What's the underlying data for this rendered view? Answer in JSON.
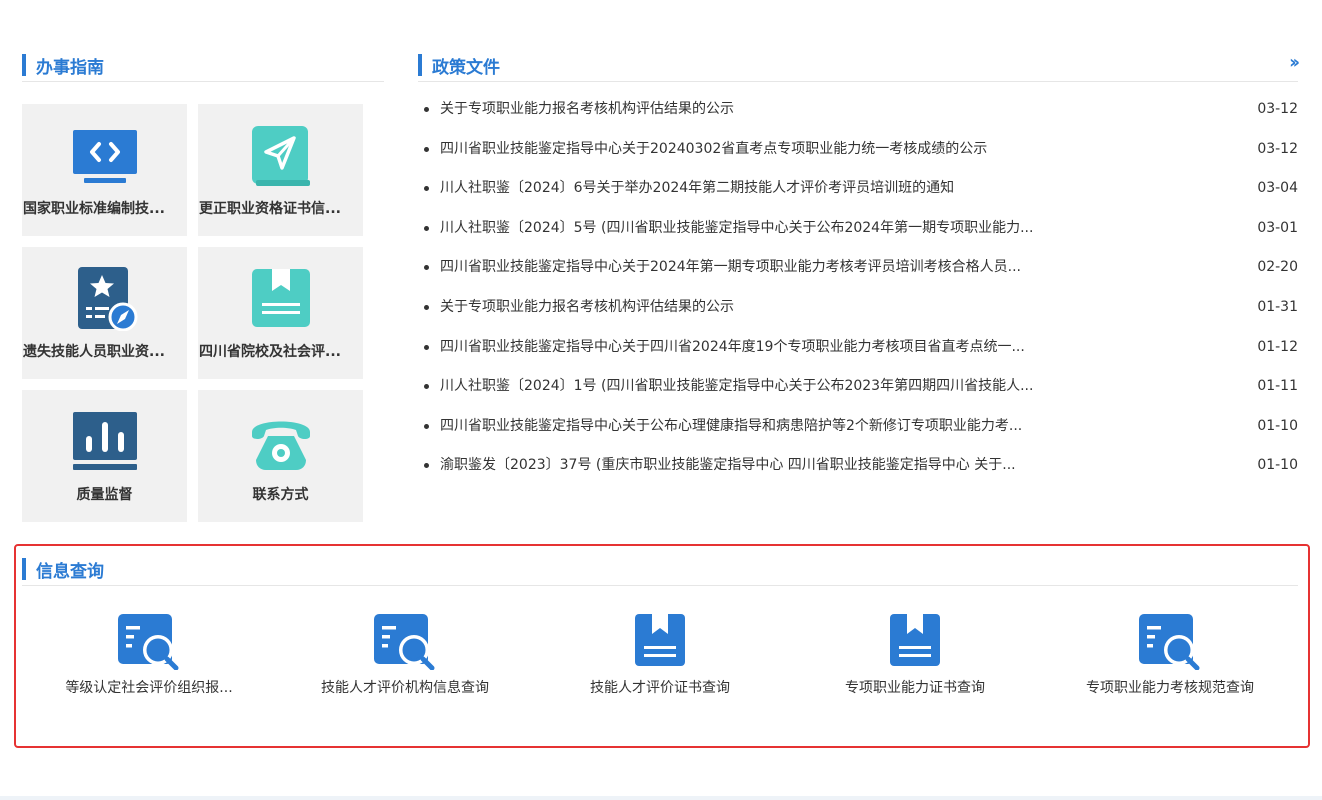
{
  "guide": {
    "title": "办事指南",
    "tiles": [
      {
        "label": "国家职业标准编制技...",
        "icon": "code-monitor-icon"
      },
      {
        "label": "更正职业资格证书信...",
        "icon": "paper-plane-book-icon"
      },
      {
        "label": "遗失技能人员职业资...",
        "icon": "star-document-compass-icon"
      },
      {
        "label": "四川省院校及社会评...",
        "icon": "bookmark-book-icon"
      },
      {
        "label": "质量监督",
        "icon": "bar-chart-icon"
      },
      {
        "label": "联系方式",
        "icon": "telephone-icon"
      }
    ]
  },
  "policy": {
    "title": "政策文件",
    "more_icon": "double-chevron-right-icon",
    "items": [
      {
        "title": "关于专项职业能力报名考核机构评估结果的公示",
        "date": "03-12"
      },
      {
        "title": "四川省职业技能鉴定指导中心关于20240302省直考点专项职业能力统一考核成绩的公示",
        "date": "03-12"
      },
      {
        "title": "川人社职鉴〔2024〕6号关于举办2024年第二期技能人才评价考评员培训班的通知",
        "date": "03-04"
      },
      {
        "title": "川人社职鉴〔2024〕5号 (四川省职业技能鉴定指导中心关于公布2024年第一期专项职业能力...",
        "date": "03-01"
      },
      {
        "title": "四川省职业技能鉴定指导中心关于2024年第一期专项职业能力考核考评员培训考核合格人员...",
        "date": "02-20"
      },
      {
        "title": "关于专项职业能力报名考核机构评估结果的公示",
        "date": "01-31"
      },
      {
        "title": "四川省职业技能鉴定指导中心关于四川省2024年度19个专项职业能力考核项目省直考点统一...",
        "date": "01-12"
      },
      {
        "title": "川人社职鉴〔2024〕1号 (四川省职业技能鉴定指导中心关于公布2023年第四期四川省技能人...",
        "date": "01-11"
      },
      {
        "title": "四川省职业技能鉴定指导中心关于公布心理健康指导和病患陪护等2个新修订专项职业能力考...",
        "date": "01-10"
      },
      {
        "title": "渝职鉴发〔2023〕37号 (重庆市职业技能鉴定指导中心 四川省职业技能鉴定指导中心 关于...",
        "date": "01-10"
      }
    ]
  },
  "query": {
    "title": "信息查询",
    "items": [
      {
        "label": "等级认定社会评价组织报...",
        "icon": "document-search-icon"
      },
      {
        "label": "技能人才评价机构信息查询",
        "icon": "document-search-icon"
      },
      {
        "label": "技能人才评价证书查询",
        "icon": "bookmark-book-icon"
      },
      {
        "label": "专项职业能力证书查询",
        "icon": "bookmark-book-icon"
      },
      {
        "label": "专项职业能力考核规范查询",
        "icon": "document-search-icon"
      }
    ]
  },
  "colors": {
    "accent": "#2b7bd3",
    "teal": "#4ecdc4",
    "navy": "#2d5f8b",
    "highlight": "#e63232"
  }
}
